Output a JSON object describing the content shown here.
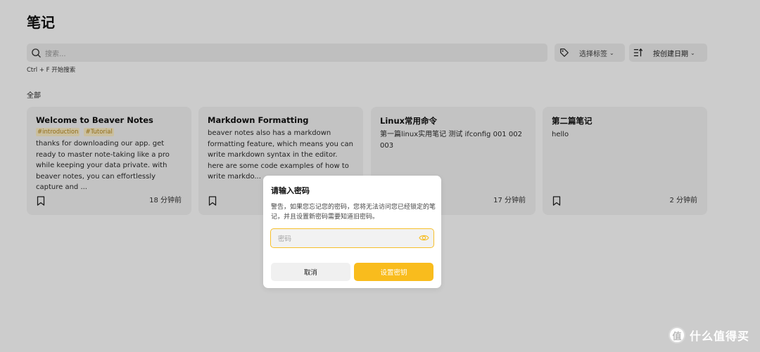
{
  "header": {
    "title": "笔记"
  },
  "search": {
    "placeholder": "搜索...",
    "hint": "Ctrl + F 开始搜索"
  },
  "toolbar": {
    "tag_filter_label": "选择标签",
    "sort_label": "按创建日期"
  },
  "section": {
    "label": "全部"
  },
  "notes": [
    {
      "title": "Welcome to Beaver Notes",
      "tags": [
        "#introduction",
        "#Tutorial"
      ],
      "body": "thanks for downloading our app. get ready to master note-taking like a pro while keeping your data private. with beaver notes, you can effortlessly capture and ...",
      "time": "18 分钟前"
    },
    {
      "title": "Markdown Formatting",
      "tags": [],
      "body": "beaver notes also has a markdown formatting feature, which means you can write markdown syntax in the editor. here are some code examples of how to write markdo...",
      "time": ""
    },
    {
      "title": "Linux常用命令",
      "tags": [],
      "body": "第一篇linux实用笔记 测试 ifconfig 001 002 003",
      "time": "17 分钟前"
    },
    {
      "title": "第二篇笔记",
      "tags": [],
      "body": "hello",
      "time": "2 分钟前"
    }
  ],
  "dialog": {
    "title": "请输入密码",
    "message": "警告，如果您忘记您的密码，您将无法访问您已经锁定的笔记，并且设置新密码需要知道旧密码。",
    "password_placeholder": "密码",
    "cancel_label": "取消",
    "confirm_label": "设置密钥"
  },
  "watermark": {
    "text": "什么值得买",
    "logo_char": "值"
  },
  "colors": {
    "accent": "#f9bc1d",
    "tag_bg": "#fdefc6",
    "tag_text": "#b7891f",
    "overlay": "rgba(0,0,0,0.2)"
  },
  "icons": {
    "search": "search-icon",
    "tag": "tag-icon",
    "sort": "sort-icon",
    "bookmark": "bookmark-icon",
    "eye": "eye-icon"
  }
}
